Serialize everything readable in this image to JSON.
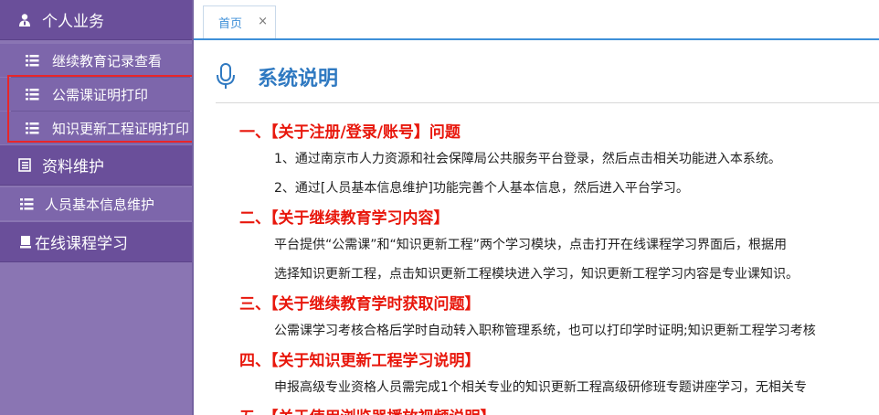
{
  "sidebar": {
    "groups": [
      {
        "label": "个人业务",
        "icon": "user-icon"
      },
      {
        "label": "资料维护",
        "icon": "document-icon"
      },
      {
        "label": "在线课程学习",
        "icon": "monitor-icon"
      }
    ],
    "items": [
      {
        "label": "继续教育记录查看",
        "icon": "list-icon"
      },
      {
        "label": "公需课证明打印",
        "icon": "list-icon"
      },
      {
        "label": "知识更新工程证明打印",
        "icon": "list-icon"
      },
      {
        "label": "人员基本信息维护",
        "icon": "list-icon"
      }
    ],
    "highlight_color": "#e8262a"
  },
  "tabs": [
    {
      "label": "首页",
      "close": "×"
    }
  ],
  "content": {
    "title": "系统说明",
    "title_icon": "microphone-icon",
    "sections": [
      {
        "heading": "一、【关于注册/登录/账号】问题",
        "paragraphs": [
          "1、通过南京市人力资源和社会保障局公共服务平台登录，然后点击相关功能进入本系统。",
          "2、通过[人员基本信息维护]功能完善个人基本信息，然后进入平台学习。"
        ]
      },
      {
        "heading": "二、【关于继续教育学习内容】",
        "paragraphs": [
          "平台提供“公需课”和“知识更新工程”两个学习模块，点击打开在线课程学习界面后，根据用",
          "选择知识更新工程，点击知识更新工程模块进入学习，知识更新工程学习内容是专业课知识。"
        ]
      },
      {
        "heading": "三、【关于继续教育学时获取问题】",
        "paragraphs": [
          "公需课学习考核合格后学时自动转入职称管理系统，也可以打印学时证明;知识更新工程学习考核"
        ]
      },
      {
        "heading": "四、【关于知识更新工程学习说明】",
        "paragraphs": [
          "申报高级专业资格人员需完成1个相关专业的知识更新工程高级研修班专题讲座学习，无相关专"
        ]
      },
      {
        "heading": "五、【关于使用浏览器播放视频说明】",
        "paragraphs": []
      }
    ]
  },
  "colors": {
    "sidebar_bg": "#8a75b3",
    "group_bg": "#6a4f9a",
    "tab_accent": "#3e8fd8",
    "heading_red": "#e8170c",
    "title_blue": "#2f79c1"
  }
}
